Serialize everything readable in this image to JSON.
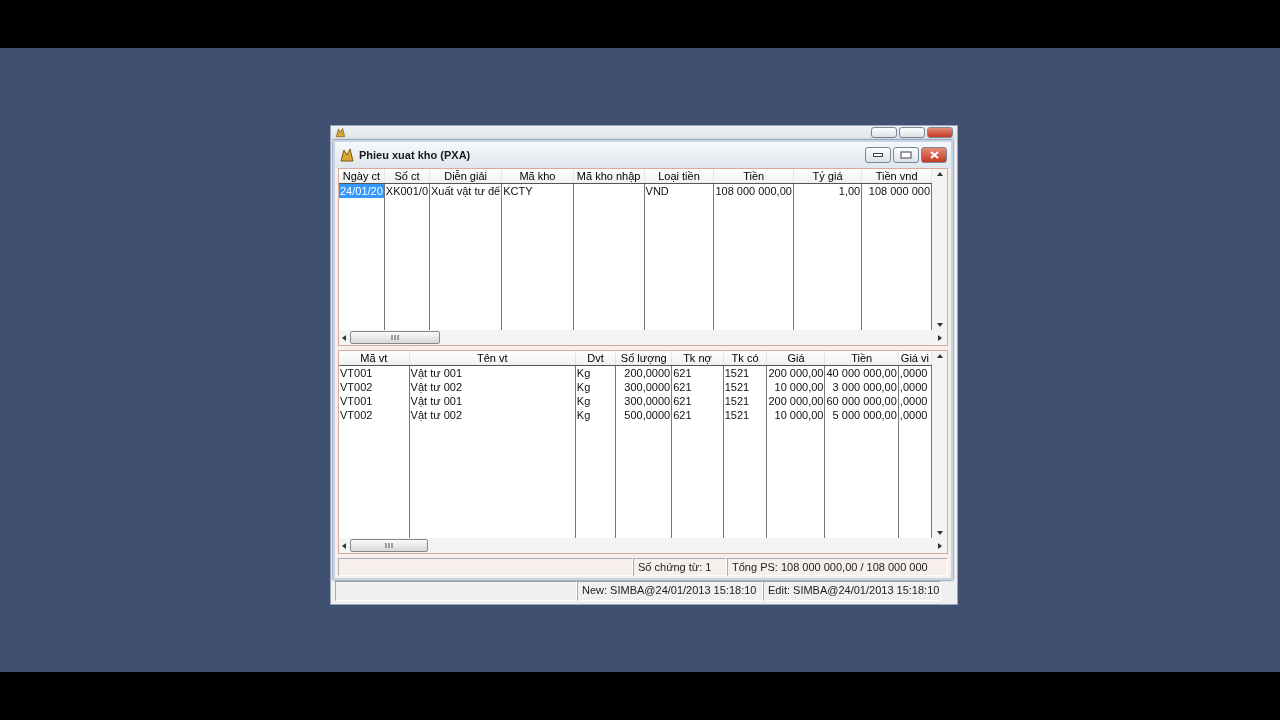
{
  "back_window": {
    "status_bar": [
      "New: SIMBA@24/01/2013 15:18:10",
      "Edit: SIMBA@24/01/2013 15:18:10"
    ]
  },
  "window": {
    "title": "Phieu xuat kho (PXA)"
  },
  "vouchers": {
    "columns": [
      "Ngày ct",
      "Số ct",
      "Diễn giải",
      "Mã kho",
      "Mã kho nhập",
      "Loại tiền",
      "Tiền",
      "Tỷ giá",
      "Tiền vnd"
    ],
    "rows": [
      {
        "cells": [
          {
            "text": "24/01/20",
            "selected": true
          },
          {
            "text": "XK001/0",
            "selected": false
          },
          {
            "text": "Xuất vật tư để",
            "selected": false
          },
          {
            "text": "KCTY",
            "selected": false
          },
          {
            "text": "",
            "selected": false
          },
          {
            "text": "VND",
            "selected": false
          },
          {
            "text": "108 000 000,00",
            "selected": false
          },
          {
            "text": "1,00",
            "selected": false
          },
          {
            "text": "108 000 000",
            "selected": false
          }
        ]
      }
    ]
  },
  "details": {
    "columns": [
      "Mã vt",
      "Tên vt",
      "Dvt",
      "Số lượng",
      "Tk nợ",
      "Tk có",
      "Giá",
      "Tiền",
      "Giá vi"
    ],
    "rows": [
      {
        "cells": [
          "VT001",
          "Vật tư 001",
          "Kg",
          "200,0000",
          "621",
          "1521",
          "200 000,00",
          "40 000 000,00",
          ",0000"
        ]
      },
      {
        "cells": [
          "VT002",
          "Vật tư 002",
          "Kg",
          "300,0000",
          "621",
          "1521",
          "10 000,00",
          "3 000 000,00",
          ",0000"
        ]
      },
      {
        "cells": [
          "VT001",
          "Vật tư 001",
          "Kg",
          "300,0000",
          "621",
          "1521",
          "200 000,00",
          "60 000 000,00",
          ",0000"
        ]
      },
      {
        "cells": [
          "VT002",
          "Vật tư 002",
          "Kg",
          "500,0000",
          "621",
          "1521",
          "10 000,00",
          "5 000 000,00",
          ",0000"
        ]
      }
    ]
  },
  "status_bar": [
    "Số chứng từ: 1",
    "Tổng PS: 108 000 000,00 / 108 000 000"
  ]
}
